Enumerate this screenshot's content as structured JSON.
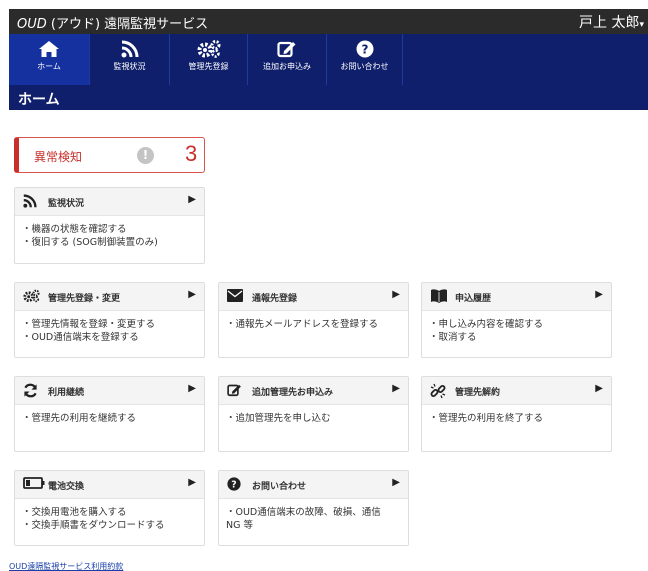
{
  "header": {
    "app_title_latin": "OUD",
    "app_title_rest": "(アウド) 遠隔監視サービス",
    "user_name": "戸上 太郎",
    "user_caret": "▾"
  },
  "nav": {
    "items": [
      {
        "label": "ホーム",
        "icon": "home-icon"
      },
      {
        "label": "監視状況",
        "icon": "rss-icon"
      },
      {
        "label": "管理先登録",
        "icon": "cogs-icon"
      },
      {
        "label": "追加お申込み",
        "icon": "edit-icon"
      },
      {
        "label": "お問い合わせ",
        "icon": "question-icon"
      }
    ]
  },
  "page_title": "ホーム",
  "alert": {
    "title": "異常検知",
    "icon_glyph": "!",
    "count": "3"
  },
  "cards": {
    "monitoring": {
      "title": "監視状況",
      "lines": [
        "・機器の状態を確認する",
        "・復旧する (SOG制御装置のみ)"
      ]
    },
    "registration": {
      "title": "管理先登録・変更",
      "lines": [
        "・管理先情報を登録・変更する",
        "・OUD通信端末を登録する"
      ]
    },
    "notification": {
      "title": "通報先登録",
      "lines": [
        "・通報先メールアドレスを登録する"
      ]
    },
    "history": {
      "title": "申込履歴",
      "lines": [
        "・申し込み内容を確認する",
        "・取消する"
      ]
    },
    "continue": {
      "title": "利用継続",
      "lines": [
        "・管理先の利用を継続する"
      ]
    },
    "additional": {
      "title": "追加管理先お申込み",
      "lines": [
        "・追加管理先を申し込む"
      ]
    },
    "cancel": {
      "title": "管理先解約",
      "lines": [
        "・管理先の利用を終了する"
      ]
    },
    "battery": {
      "title": "電池交換",
      "lines": [
        "・交換用電池を購入する",
        "・交換手順書をダウンロードする"
      ]
    },
    "contact": {
      "title": "お問い合わせ",
      "lines": [
        "・OUD通信端末の故障、破損、通信",
        "NG 等"
      ]
    }
  },
  "arrow_glyph": "▶",
  "footer_link": "OUD遠隔監視サービス利用約款"
}
